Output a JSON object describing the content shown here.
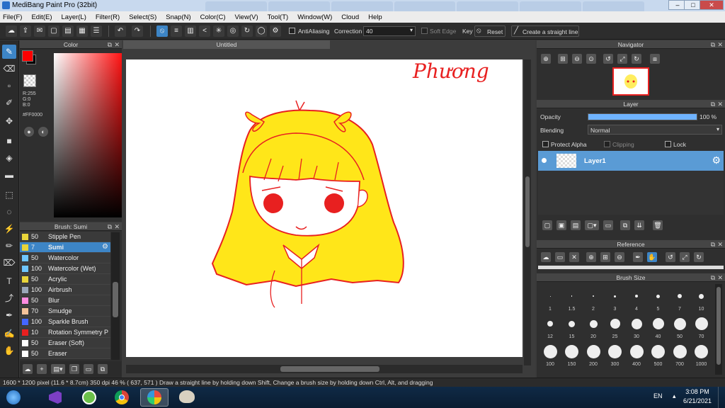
{
  "window": {
    "title": "MediBang Paint Pro (32bit)",
    "minimize": "–",
    "maximize": "□",
    "close": "✕"
  },
  "menu": [
    "File(F)",
    "Edit(E)",
    "Layer(L)",
    "Filter(R)",
    "Select(S)",
    "Snap(N)",
    "Color(C)",
    "View(V)",
    "Tool(T)",
    "Window(W)",
    "Cloud",
    "Help"
  ],
  "toolbar": {
    "antialiasing_label": "AntiAliasing",
    "correction_label": "Correction",
    "correction_value": "40",
    "soft_edge_label": "Soft Edge",
    "key_label": "Key",
    "reset_label": "Reset",
    "straight_line_label": "Create a straight line"
  },
  "color_panel": {
    "title": "Color",
    "r": "R:255",
    "g": "G:0",
    "b": "B:0",
    "hex": "#FF0000",
    "foreground": "#ff0000",
    "background": "#000000"
  },
  "brush_panel": {
    "title": "Brush: Sumi",
    "items": [
      {
        "size": "50",
        "name": "Stipple Pen",
        "color": "#e8d43a"
      },
      {
        "size": "7",
        "name": "Sumi",
        "color": "#e8d43a",
        "selected": true
      },
      {
        "size": "50",
        "name": "Watercolor",
        "color": "#6ec6ff"
      },
      {
        "size": "100",
        "name": "Watercolor (Wet)",
        "color": "#6ec6ff"
      },
      {
        "size": "50",
        "name": "Acrylic",
        "color": "#e8d43a"
      },
      {
        "size": "100",
        "name": "Airbrush",
        "color": "#9aa6b8"
      },
      {
        "size": "50",
        "name": "Blur",
        "color": "#ff8be0"
      },
      {
        "size": "70",
        "name": "Smudge",
        "color": "#f3c29a"
      },
      {
        "size": "100",
        "name": "Sparkle Brush",
        "color": "#4466ff"
      },
      {
        "size": "10",
        "name": "Rotation Symmetry P",
        "color": "#e82020"
      },
      {
        "size": "50",
        "name": "Eraser (Soft)",
        "color": "#ffffff"
      },
      {
        "size": "50",
        "name": "Eraser",
        "color": "#ffffff"
      }
    ]
  },
  "document": {
    "tab_title": "Untitled",
    "signature": "Phương"
  },
  "navigator": {
    "title": "Navigator"
  },
  "layer_panel": {
    "title": "Layer",
    "opacity_label": "Opacity",
    "opacity_value": "100 %",
    "opacity": 1.0,
    "blending_label": "Blending",
    "blending_value": "Normal",
    "protect_alpha_label": "Protect Alpha",
    "clipping_label": "Clipping",
    "lock_label": "Lock",
    "layers": [
      {
        "name": "Layer1"
      }
    ]
  },
  "reference_panel": {
    "title": "Reference"
  },
  "brush_size_panel": {
    "title": "Brush Size",
    "sizes": [
      "1",
      "1.5",
      "2",
      "3",
      "4",
      "5",
      "7",
      "10",
      "12",
      "15",
      "20",
      "25",
      "30",
      "40",
      "50",
      "70",
      "100",
      "150",
      "200",
      "300",
      "400",
      "500",
      "700",
      "1000"
    ]
  },
  "status_bar": {
    "text": "1600 * 1200 pixel   (11.6 * 8.7cm)   350 dpi   46 %   ( 637, 571 )   Draw a straight line by holding down Shift, Change a brush size by holding down Ctrl, Alt, and dragging"
  },
  "taskbar": {
    "language": "EN",
    "time": "3:08 PM",
    "date": "6/21/2021"
  }
}
